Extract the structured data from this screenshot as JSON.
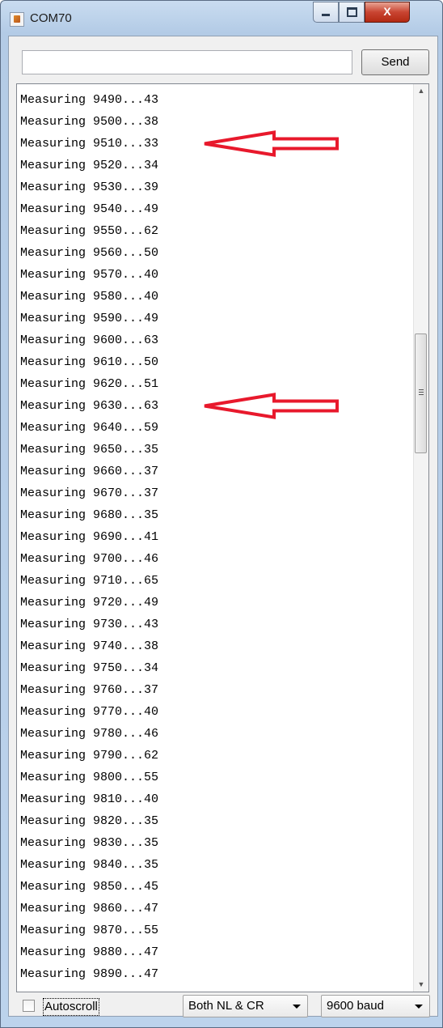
{
  "window": {
    "title": "COM70",
    "close_glyph": "X"
  },
  "input": {
    "value": "",
    "send_label": "Send"
  },
  "log_lines": [
    "Measuring 9490...43",
    "Measuring 9500...38",
    "Measuring 9510...33",
    "Measuring 9520...34",
    "Measuring 9530...39",
    "Measuring 9540...49",
    "Measuring 9550...62",
    "Measuring 9560...50",
    "Measuring 9570...40",
    "Measuring 9580...40",
    "Measuring 9590...49",
    "Measuring 9600...63",
    "Measuring 9610...50",
    "Measuring 9620...51",
    "Measuring 9630...63",
    "Measuring 9640...59",
    "Measuring 9650...35",
    "Measuring 9660...37",
    "Measuring 9670...37",
    "Measuring 9680...35",
    "Measuring 9690...41",
    "Measuring 9700...46",
    "Measuring 9710...65",
    "Measuring 9720...49",
    "Measuring 9730...43",
    "Measuring 9740...38",
    "Measuring 9750...34",
    "Measuring 9760...37",
    "Measuring 9770...40",
    "Measuring 9780...46",
    "Measuring 9790...62",
    "Measuring 9800...55",
    "Measuring 9810...40",
    "Measuring 9820...35",
    "Measuring 9830...35",
    "Measuring 9840...35",
    "Measuring 9850...45",
    "Measuring 9860...47",
    "Measuring 9870...55",
    "Measuring 9880...47",
    "Measuring 9890...47"
  ],
  "annotations": {
    "arrow_color": "#e8192c",
    "arrow_targets": [
      2,
      14
    ]
  },
  "footer": {
    "autoscroll_label": "Autoscroll",
    "autoscroll_checked": false,
    "line_ending": "Both NL & CR",
    "baud": "9600 baud"
  },
  "scrollbar": {
    "position_fraction": 0.31
  }
}
